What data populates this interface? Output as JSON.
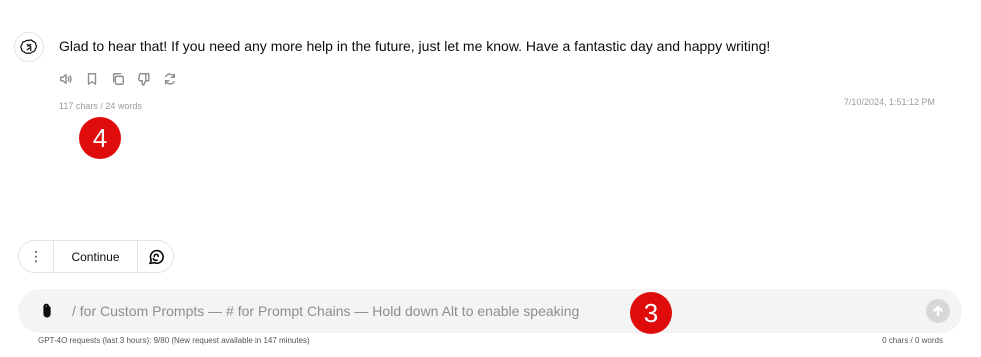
{
  "message": {
    "text": "Glad to hear that! If you need any more help in the future, just let me know. Have a fantastic day and happy writing!",
    "stats": "117 chars / 24 words",
    "timestamp": "7/10/2024, 1:51:12 PM",
    "actions": [
      "speaker-icon",
      "bookmark-icon",
      "copy-icon",
      "thumbs-down-icon",
      "regenerate-icon"
    ]
  },
  "annotations": {
    "badge_message": "4",
    "badge_composer": "3"
  },
  "toolbar": {
    "more_label": "⋮",
    "continue_label": "Continue",
    "voice_icon": "voice-chat-icon"
  },
  "composer": {
    "placeholder": "/ for Custom Prompts — # for Prompt Chains — Hold down Alt to enable speaking",
    "value": "",
    "stats": "0 chars / 0 words",
    "quota": "GPT-4O requests (last 3 hours): 9/80 (New request available in 147 minutes)"
  },
  "colors": {
    "badge": "#e00b0b",
    "composer_bg": "#f4f4f4",
    "muted_text": "#9b9b9b"
  }
}
